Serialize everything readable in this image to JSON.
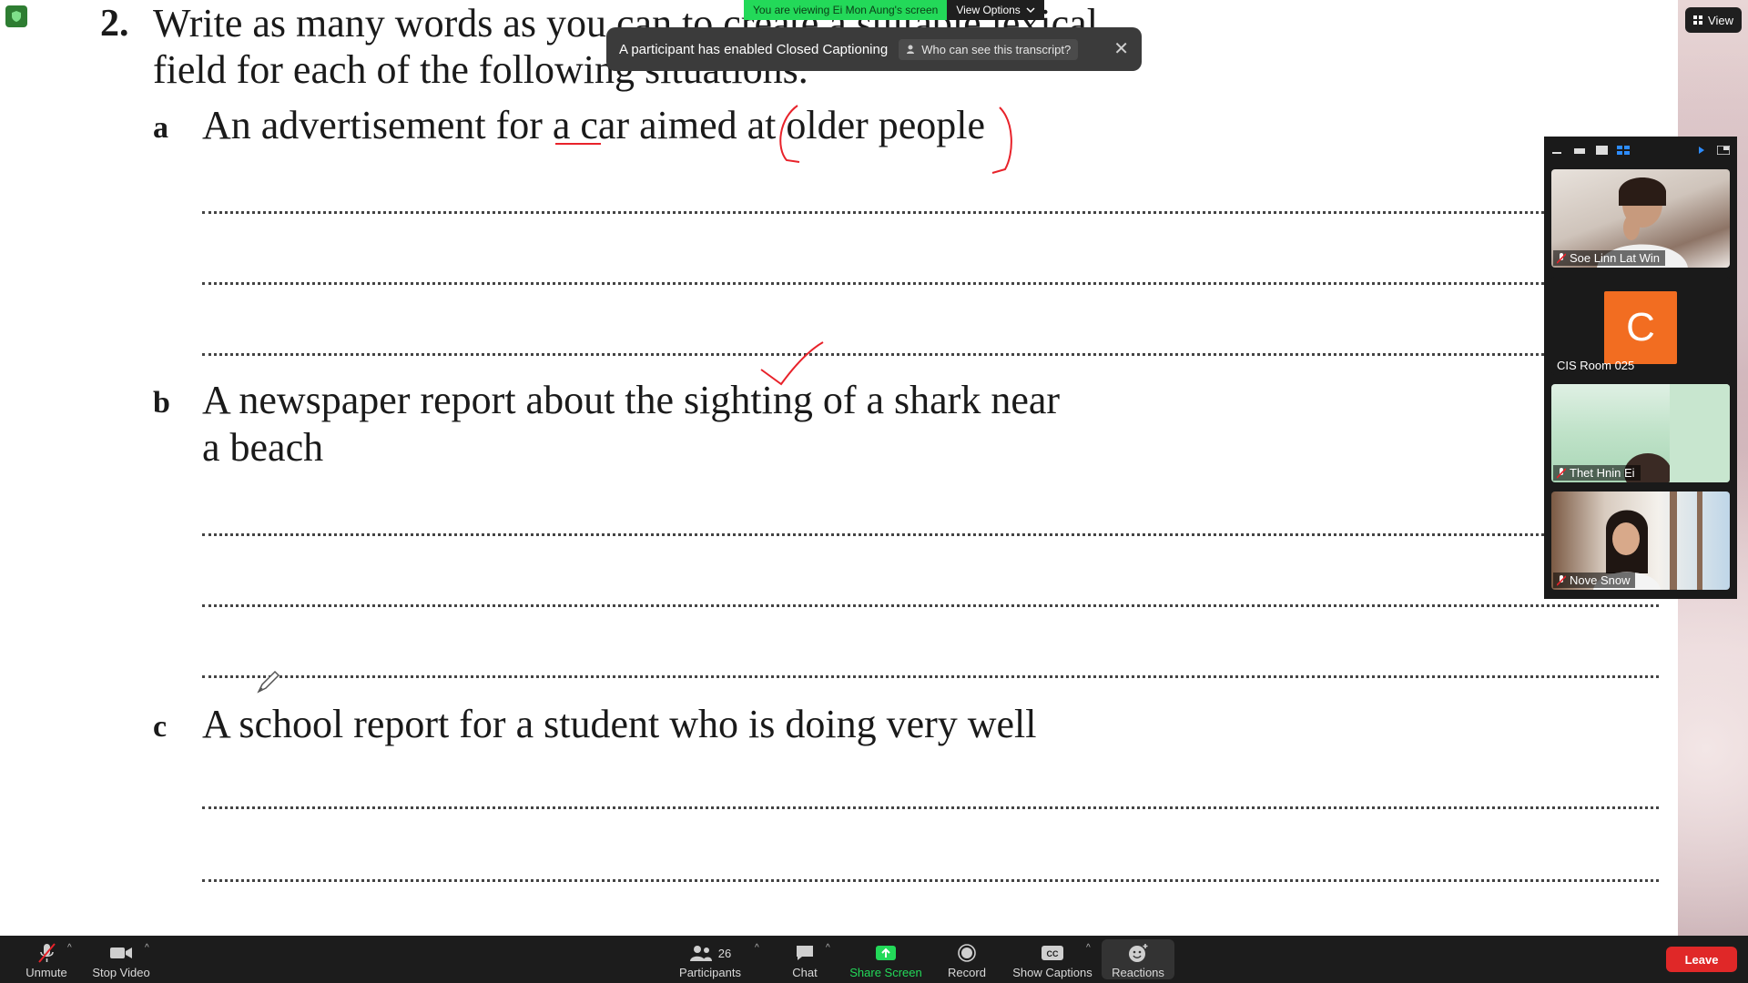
{
  "document": {
    "question_number": "2.",
    "question_line1": "Write as many words as you can to create a suitable lexical",
    "question_line2": "field for each of the following situations.",
    "items": [
      {
        "letter": "a",
        "text": "An advertisement for a car aimed at older people"
      },
      {
        "letter": "b",
        "text_line1": "A newspaper report about the sighting of a shark near",
        "text_line2": "a beach"
      },
      {
        "letter": "c",
        "text": "A school report for a student who is doing very well"
      }
    ]
  },
  "banner": {
    "viewing_text": "You are viewing Ei Mon Aung's screen",
    "view_options_label": "View Options"
  },
  "caption_toast": {
    "message": "A participant has enabled Closed Captioning",
    "who_label": "Who can see this transcript?"
  },
  "view_button": {
    "label": "View"
  },
  "gallery": {
    "participants": [
      {
        "name": "Soe Linn Lat Win",
        "muted": true
      },
      {
        "name": "CIS Room 025",
        "initial": "C",
        "muted": false
      },
      {
        "name": "Thet Hnin Ei",
        "muted": true
      },
      {
        "name": "Nove Snow",
        "muted": true
      }
    ]
  },
  "toolbar": {
    "unmute_label": "Unmute",
    "stop_video_label": "Stop Video",
    "participants_label": "Participants",
    "participants_count": "26",
    "chat_label": "Chat",
    "share_screen_label": "Share Screen",
    "record_label": "Record",
    "show_captions_label": "Show Captions",
    "reactions_label": "Reactions",
    "leave_label": "Leave"
  },
  "colors": {
    "share_green": "#23d959",
    "leave_red": "#e02828",
    "annotation_red": "#e8222a",
    "avatar_orange": "#f26d21"
  }
}
